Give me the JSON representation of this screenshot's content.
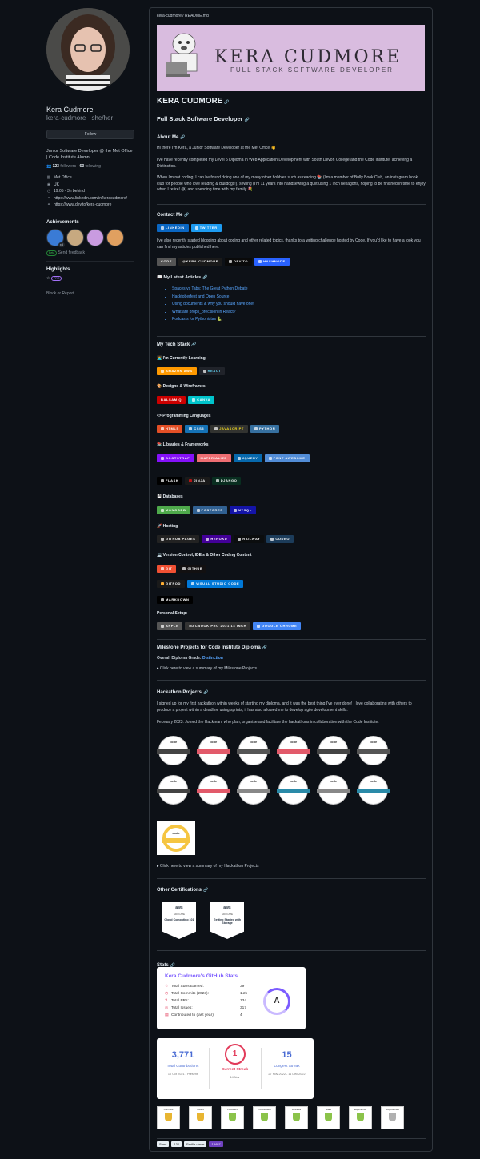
{
  "sidebar": {
    "name": "Kera Cudmore",
    "login": "kera-cudmore · she/her",
    "follow_label": "Follow",
    "bio": "Junior Software Developer @ the Met Office | Code Institute Alumni",
    "followers_count": "123",
    "followers_label": "followers",
    "following_count": "63",
    "following_label": "following",
    "company": "Met Office",
    "location": "UK",
    "local_time": "19:05 - 3h behind",
    "links": [
      "https://www.linkedin.com/in/keracudmore/",
      "https://www.dev.to/kera-cudmore"
    ],
    "achievements_title": "Achievements",
    "achievement_count": "x3",
    "beta_label": "Beta",
    "send_feedback": "Send feedback",
    "highlights_title": "Highlights",
    "pro_label": "PRO",
    "block_report": "Block or Report"
  },
  "readme": {
    "path": "kera-cudmore / README.md",
    "banner_title": "KERA CUDMORE",
    "banner_subtitle": "FULL STACK SOFTWARE DEVELOPER",
    "title": "KERA CUDMORE",
    "subtitle": "Full Stack Software Developer",
    "about_heading": "About Me",
    "about_p1": "Hi there I'm Kera, a Junior Software Developer at the Met Office 👋",
    "about_p2": "I've have recently completed my Level 5 Diploma in Web Application Development with South Devon College and the Code Institute, achieving a Distinction.",
    "about_p3": "When I'm not coding, I can be found doing one of my many other hobbies such as reading 📚 (I'm a member of Bully Book Club, an instagram book club for people who love reading & Bulldogs!), sewing (I'm 11 years into handsewing a quilt using 1 inch hexagons, hoping to be finished in time to enjoy when I retire! 😅) and spending time with my family 💐.",
    "contact_heading": "Contact Me",
    "contact_badges": [
      "LinkedIn",
      "Twitter"
    ],
    "contact_p": "I've also recently started blogging about coding and other related topics, thanks to a writing challenge hosted by Code. If you'd like to have a look you can find my articles published here:",
    "blog_badges": [
      "Code",
      "@KERA-CUDMORE",
      "DEV.TO",
      "HASHNODE"
    ],
    "articles_heading": "📖 My Latest Articles",
    "articles": [
      "Spaces vs Tabs: The Great Python Debate",
      "Hacktoberfest and Open Source",
      "Using documents & why you should have one!",
      "What are props_precision in React?",
      "Podcasts for Pythonistas 🐍"
    ],
    "tech_heading": "My Tech Stack",
    "learning_heading": "🧑‍💻 I'm Currently Learning",
    "learning_badges": [
      "Amazon AWS",
      "React"
    ],
    "design_heading": "🎨 Designs & Wireframes",
    "design_badges": [
      "Balsamiq",
      "Canva"
    ],
    "lang_heading": "<> Programming Languages",
    "lang_badges": [
      "HTML5",
      "CSS3",
      "JavaScript",
      "Python"
    ],
    "lib_heading": "📚 Libraries & Frameworks",
    "lib_badges_1": [
      "Bootstrap",
      "Materialize",
      "jQuery",
      "Font Awesome"
    ],
    "lib_badges_2": [
      "Flask",
      "Jinja",
      "Django"
    ],
    "db_heading": "💾 Databases",
    "db_badges": [
      "MongoDB",
      "Postgres",
      "MySQL"
    ],
    "host_heading": "🚀 Hosting",
    "host_badges": [
      "GitHub Pages",
      "Heroku",
      "Railway",
      "Codeo"
    ],
    "vc_heading": "💻 Version Control, IDE's & Other Coding Content",
    "vc_badges_1": [
      "Git",
      "GitHub"
    ],
    "vc_badges_2": [
      "Gitpod",
      "Visual Studio Code"
    ],
    "vc_badges_3": [
      "Markdown"
    ],
    "setup_heading": "Personal Setup:",
    "setup_badges": [
      "Apple",
      "MacBook Pro 2021 14 inch",
      "Google Chrome"
    ],
    "milestone_heading": "Milestone Projects for Code Institute Diploma",
    "grade_label": "Overall Diploma Grade:",
    "grade_value": "Distinction",
    "milestone_summary": "▸ Click here to view a summary of my Milestone Projects",
    "hackathon_heading": "Hackathon Projects",
    "hackathon_p1": "I signed up for my first hackathon within weeks of starting my diploma, and it was the best thing I've ever done! I love collaborating with others to produce a project within a deadline using sprints, it has also allowed me to develop agile development skills.",
    "hackathon_p2": "February 2023: Joined the Hackteam who plan, organise and facilitate the hackathons in collaboration with the Code Institute.",
    "cert_label": "code",
    "hackathon_summary": "▸ Click here to view a summary of my Hackathon Projects",
    "other_cert_heading": "Other Certifications",
    "aws_badges": [
      {
        "brand": "aws",
        "level": "EDUCATE",
        "title": "Cloud Computing 101"
      },
      {
        "brand": "aws",
        "level": "EDUCATE",
        "title": "Getting Started with Storage"
      }
    ],
    "stats_heading": "Stats",
    "stats_card": {
      "title": "Kera Cudmore's GitHub Stats",
      "rows": [
        {
          "label": "Total Stars Earned:",
          "value": "39"
        },
        {
          "label": "Total Commits (2023):",
          "value": "1.2k"
        },
        {
          "label": "Total PRs:",
          "value": "134"
        },
        {
          "label": "Total Issues:",
          "value": "317"
        },
        {
          "label": "Contributed to (last year):",
          "value": "4"
        }
      ],
      "grade": "A"
    },
    "streak": {
      "total": "3,771",
      "total_label": "Total Contributions",
      "total_range": "10 Oct 2021 - Present",
      "current": "1",
      "current_label": "Current Streak",
      "current_date": "14 Nov",
      "longest": "15",
      "longest_label": "Longest Streak",
      "longest_range": "27 Nov 2022 - 11 Dec 2022"
    },
    "trophies": [
      "Commits",
      "Issues",
      "Followers",
      "PullRequest",
      "Reviews",
      "Stars",
      "Experience",
      "Repositories"
    ],
    "footer_badges": [
      "Stars",
      "132",
      "Profile views",
      "13407"
    ]
  },
  "colors": {
    "bg": "#0d1117",
    "banner": "#d9bcdf",
    "link": "#58a6ff"
  }
}
